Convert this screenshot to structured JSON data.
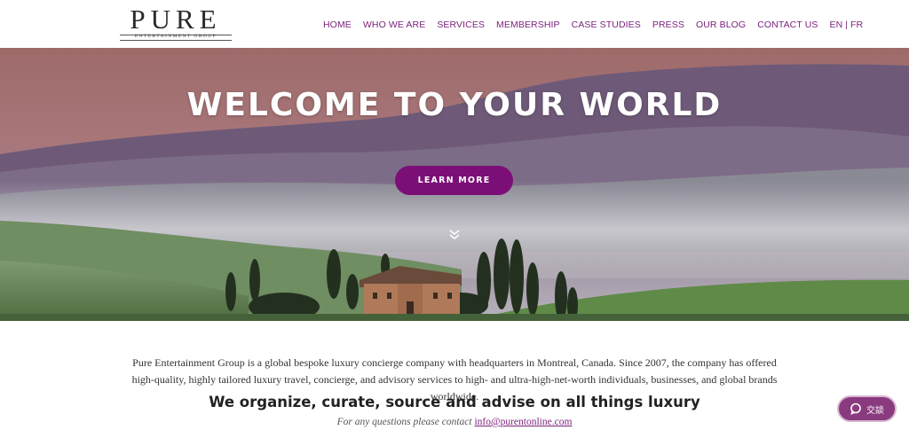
{
  "brand": {
    "name": "PURE",
    "subtitle": "ENTERTAINMENT GROUP",
    "accent_color": "#7b0f77"
  },
  "nav": {
    "items": [
      "HOME",
      "WHO WE ARE",
      "SERVICES",
      "MEMBERSHIP",
      "CASE STUDIES",
      "PRESS",
      "OUR BLOG",
      "CONTACT US"
    ],
    "lang_en": "EN",
    "lang_sep": "|",
    "lang_fr": "FR"
  },
  "hero": {
    "title": "WELCOME TO YOUR WORLD",
    "cta_label": "LEARN MORE",
    "scroll_icon": "double-chevron-down-icon"
  },
  "content": {
    "intro": "Pure Entertainment Group is a global bespoke luxury concierge company with headquarters in Montreal, Canada. Since 2007, the company has offered high-quality, highly tailored luxury travel, concierge, and advisory services to high- and ultra-high-net-worth individuals, businesses, and global brands worldwide.",
    "tagline": "We organize, curate, source and advise on all things luxury",
    "contact_prefix": "For any questions please contact",
    "contact_email": "info@purentonline.com"
  },
  "chat": {
    "label": "交談",
    "icon": "chat-bubble-icon"
  }
}
